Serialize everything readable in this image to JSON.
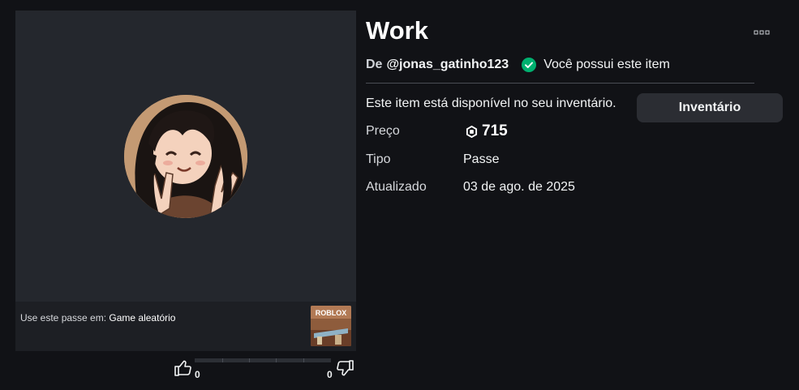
{
  "item": {
    "title": "Work",
    "creator_prefix": "De",
    "creator_name": "@jonas_gatinho123",
    "owned_text": "Você possui este item",
    "availability_text": "Este item está disponível no seu inventário.",
    "inventory_button": "Inventário"
  },
  "details": {
    "price_label": "Preço",
    "price_value": "715",
    "type_label": "Tipo",
    "type_value": "Passe",
    "updated_label": "Atualizado",
    "updated_value": "03 de ago. de 2025"
  },
  "game": {
    "prefix": "Use este passe em:",
    "name": "Game aleatório",
    "thumb_text": "ROBLOX"
  },
  "votes": {
    "up_count": "0",
    "down_count": "0"
  },
  "icons": {
    "owned": "checkmark-circle-icon",
    "price": "robux-icon",
    "more": "ellipsis-icon",
    "upvote": "thumbs-up-icon",
    "downvote": "thumbs-down-icon"
  },
  "colors": {
    "background": "#111216",
    "panel": "#24272d",
    "owned_green": "#00b06f",
    "button": "#2b2d33"
  }
}
